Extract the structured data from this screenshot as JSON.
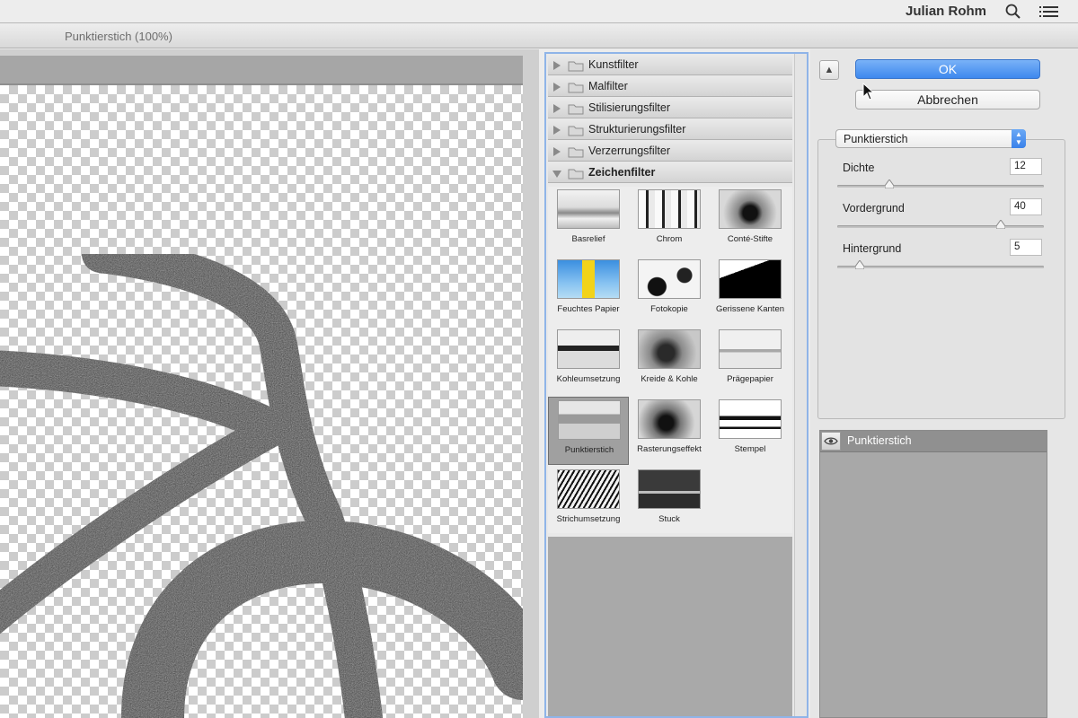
{
  "menubar": {
    "user_name": "Julian Rohm",
    "search_icon": "search-icon",
    "menu_icon": "list-icon"
  },
  "window": {
    "title": "Punktierstich (100%)"
  },
  "gallery": {
    "categories": [
      {
        "label": "Kunstfilter",
        "expanded": false
      },
      {
        "label": "Malfilter",
        "expanded": false
      },
      {
        "label": "Stilisierungsfilter",
        "expanded": false
      },
      {
        "label": "Strukturierungsfilter",
        "expanded": false
      },
      {
        "label": "Verzerrungsfilter",
        "expanded": false
      },
      {
        "label": "Zeichenfilter",
        "expanded": true
      }
    ],
    "filters": [
      {
        "label": "Basrelief"
      },
      {
        "label": "Chrom"
      },
      {
        "label": "Conté-Stifte"
      },
      {
        "label": "Feuchtes Papier"
      },
      {
        "label": "Fotokopie"
      },
      {
        "label": "Gerissene Kanten"
      },
      {
        "label": "Kohleumsetzung"
      },
      {
        "label": "Kreide & Kohle"
      },
      {
        "label": "Prägepapier"
      },
      {
        "label": "Punktierstich",
        "selected": true
      },
      {
        "label": "Rasterungseffekt"
      },
      {
        "label": "Stempel"
      },
      {
        "label": "Strichumsetzung"
      },
      {
        "label": "Stuck"
      }
    ]
  },
  "dialog": {
    "ok_label": "OK",
    "cancel_label": "Abbrechen",
    "collapse_icon": "chevron-up-icon",
    "selected_filter": "Punktierstich",
    "params": [
      {
        "label": "Dichte",
        "value": "12",
        "fraction": 0.25
      },
      {
        "label": "Vordergrund",
        "value": "40",
        "fraction": 0.79
      },
      {
        "label": "Hintergrund",
        "value": "5",
        "fraction": 0.11
      }
    ],
    "accent_color": "#3d88ee"
  },
  "layers": {
    "items": [
      {
        "label": "Punktierstich",
        "visible": true
      }
    ]
  }
}
